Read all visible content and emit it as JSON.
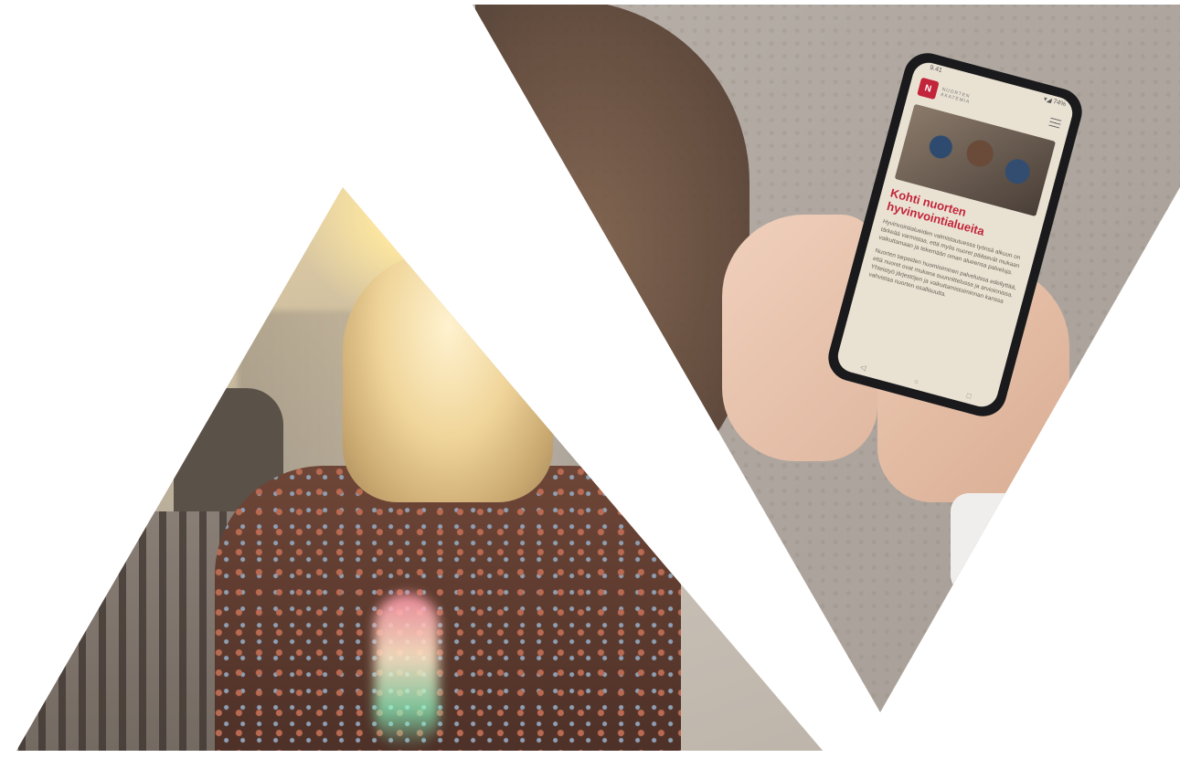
{
  "images": {
    "left_photo": "woman-walking-into-sunlight-photo",
    "right_photo": "hands-holding-phone-photo"
  },
  "phone": {
    "status_time": "9.41",
    "status_icons": "▾◢ 74%",
    "logo_mark": "N",
    "logo_text_1": "NUORTEN",
    "logo_text_2": "AKATEMIA",
    "headline": "Kohti nuorten hyvinvointialueita",
    "paragraph_1": "Hyvinvointialueiden valmistautuessa työnsä alkuun on tärkeää varmistaa, että myös nuoret pääsevät mukaan vaikuttamaan ja tekemään oman alueensa palveluja.",
    "paragraph_2": "Nuorten tarpeiden huomioiminen palveluissa edellyttää, että nuoret ovat mukana suunnittelussa ja arvioinnissa. Yhteistyö järjestöjen ja vaikuttamistoiminnan kanssa vahvistaa nuorten osallisuutta.",
    "nav_back": "◁",
    "nav_home": "○",
    "nav_recent": "□"
  },
  "colors": {
    "brand_red": "#c2243a",
    "background": "#ffffff"
  }
}
